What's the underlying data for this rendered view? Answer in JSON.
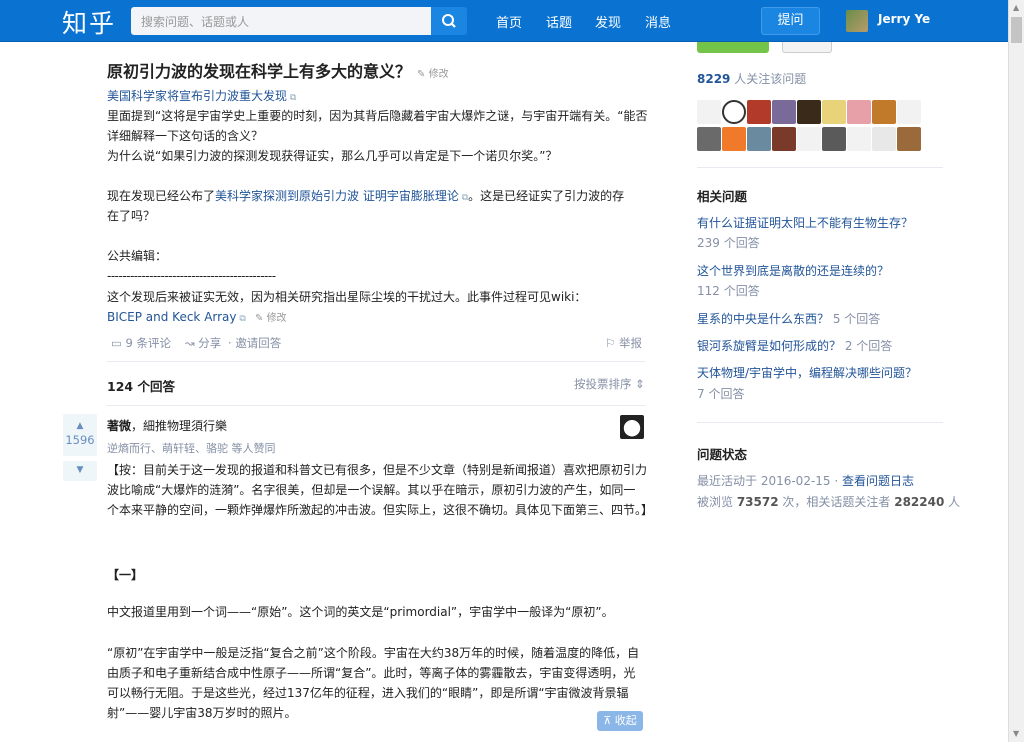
{
  "header": {
    "logo": "知乎",
    "search_placeholder": "搜索问题、话题或人",
    "nav": [
      "首页",
      "话题",
      "发现",
      "消息"
    ],
    "ask_label": "提问",
    "username": "Jerry Ye"
  },
  "question": {
    "title": "原初引力波的发现在科学上有多大的意义？",
    "edit_label": "修改",
    "source_link": "美国科学家将宣布引力波重大发现",
    "body_line1": "里面提到“这将是宇宙学史上重要的时刻，因为其背后隐藏着宇宙大爆炸之谜，与宇宙开端有关。“能否",
    "body_line2": "详细解释一下这句话的含义？",
    "body_line3": "为什么说“如果引力波的探测发现获得证实，那么几乎可以肯定是下一个诺贝尔奖。”？",
    "body_line4_pre": "现在发现已经公布了",
    "body_line4_link1": "美科学家探测到原始引力波 证明宇宙膨胀理论",
    "body_line4_post": "。这是已经证实了引力波的存",
    "body_line5": "在了吗？",
    "public_edit": "公共编辑：",
    "dashes": "--------------------------------------------",
    "correction": "这个发现后来被证实无效，因为相关研究指出星际尘埃的干扰过大。此事件过程可见wiki：",
    "wiki_link": "BICEP and Keck Array",
    "wiki_edit": "修改",
    "comments": "9 条评论",
    "share": "分享",
    "invite": "邀请回答",
    "report": "举报"
  },
  "answers_header": {
    "count": "124 个回答",
    "sort": "按投票排序"
  },
  "answer": {
    "votes": "1596",
    "author": "著微",
    "author_bio": "，細推物理須行樂",
    "voters": "逆熵而行、萌轩轾、骆驼 等人赞同",
    "para1": "【按：目前关于这一发现的报道和科普文已有很多，但是不少文章（特别是新闻报道）喜欢把原初引力波比喻成“大爆炸的涟漪”。名字很美，但却是一个误解。其以乎在暗示，原初引力波的产生，如同一个本来平静的空间，一颗炸弹爆炸所激起的冲击波。但实际上，这很不确切。具体见下面第三、四节。】",
    "section": "【一】",
    "para2": "中文报道里用到一个词——“原始”。这个词的英文是“primordial”，宇宙学中一般译为“原初”。",
    "para3": "“原初”在宇宙学中一般是泛指“复合之前”这个阶段。宇宙在大约38万年的时候，随着温度的降低，自由质子和电子重新结合成中性原子——所谓“复合”。此时，等离子体的雾霾散去，宇宙变得透明，光可以畅行无阻。于是这些光，经过137亿年的征程，进入我们的“眼睛”，即是所谓“宇宙微波背景辐射”——婴儿宇宙38万岁时的照片。",
    "collapse": "收起"
  },
  "sidebar": {
    "followers_count": "8229",
    "followers_label": " 人关注该问题",
    "related_title": "相关问题",
    "related": [
      {
        "q": "有什么证据证明太阳上不能有生物生存？",
        "a": "239 个回答",
        "inline": false
      },
      {
        "q": "这个世界到底是离散的还是连续的？",
        "a": "112 个回答",
        "inline": false
      },
      {
        "q": "星系的中央是什么东西？",
        "a": "5 个回答",
        "inline": true
      },
      {
        "q": "银河系旋臂是如何形成的？",
        "a": "2 个回答",
        "inline": true
      },
      {
        "q": "天体物理/宇宙学中，编程解决哪些问题？",
        "a": "7 个回答",
        "inline": false
      }
    ],
    "status_title": "问题状态",
    "status_line1_pre": "最近活动于 2016-02-15 · ",
    "status_log": "查看问题日志",
    "status_line2_pre": "被浏览 ",
    "views": "73572",
    "status_line2_mid": " 次，相关话题关注者 ",
    "topic_followers": "282240",
    "status_line2_post": " 人"
  },
  "colors": {
    "header_bg": "#0a73d1",
    "link": "#225599",
    "meta": "#8590a6"
  }
}
